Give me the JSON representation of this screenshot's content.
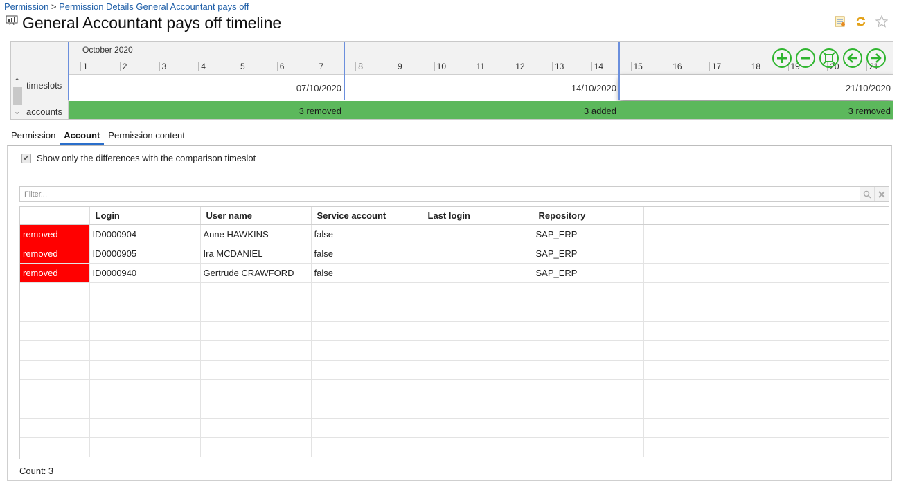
{
  "breadcrumb": {
    "root": "Permission",
    "separator": ">",
    "current": "Permission Details General Accountant pays off"
  },
  "page": {
    "title": "General Accountant pays off timeline"
  },
  "timeline": {
    "month": "October 2020",
    "days": [
      "1",
      "2",
      "3",
      "4",
      "5",
      "6",
      "7",
      "8",
      "9",
      "10",
      "11",
      "12",
      "13",
      "14",
      "15",
      "16",
      "17",
      "18",
      "19",
      "20",
      "21"
    ],
    "rows": {
      "timeslots": "timeslots",
      "accounts": "accounts"
    },
    "slots": [
      {
        "date": "07/10/2020",
        "accounts": "3 removed",
        "selected": false
      },
      {
        "date": "14/10/2020",
        "accounts": "3 added",
        "selected": false
      },
      {
        "date": "21/10/2020",
        "accounts": "3 removed",
        "selected": true
      }
    ]
  },
  "tabs": [
    {
      "label": "Permission",
      "active": false
    },
    {
      "label": "Account",
      "active": true
    },
    {
      "label": "Permission content",
      "active": false
    }
  ],
  "options": {
    "show_diff_label": "Show only the differences with the comparison timeslot",
    "show_diff_checked": true
  },
  "filter": {
    "placeholder": "Filter...",
    "value": ""
  },
  "table": {
    "columns": [
      "",
      "Login",
      "User name",
      "Service account",
      "Last login",
      "Repository"
    ],
    "rows": [
      {
        "status": "removed",
        "login": "ID0000904",
        "user_name": "Anne HAWKINS",
        "service_account": "false",
        "last_login": "",
        "repository": "SAP_ERP"
      },
      {
        "status": "removed",
        "login": "ID0000905",
        "user_name": "Ira MCDANIEL",
        "service_account": "false",
        "last_login": "",
        "repository": "SAP_ERP"
      },
      {
        "status": "removed",
        "login": "ID0000940",
        "user_name": "Gertrude CRAWFORD",
        "service_account": "false",
        "last_login": "",
        "repository": "SAP_ERP"
      }
    ],
    "empty_rows": 9
  },
  "footer": {
    "count": "Count: 3"
  },
  "colors": {
    "accent": "#2a6ecb",
    "removed": "#ff0000",
    "accounts_bar": "#5cb85c",
    "timeline_controls": "#2fb52f"
  },
  "icons": [
    "chart-icon",
    "report-icon",
    "refresh-icon",
    "star-icon",
    "zoom-in-icon",
    "zoom-out-icon",
    "fit-icon",
    "previous-icon",
    "next-icon",
    "search-icon",
    "clear-icon",
    "checkmark-icon"
  ]
}
